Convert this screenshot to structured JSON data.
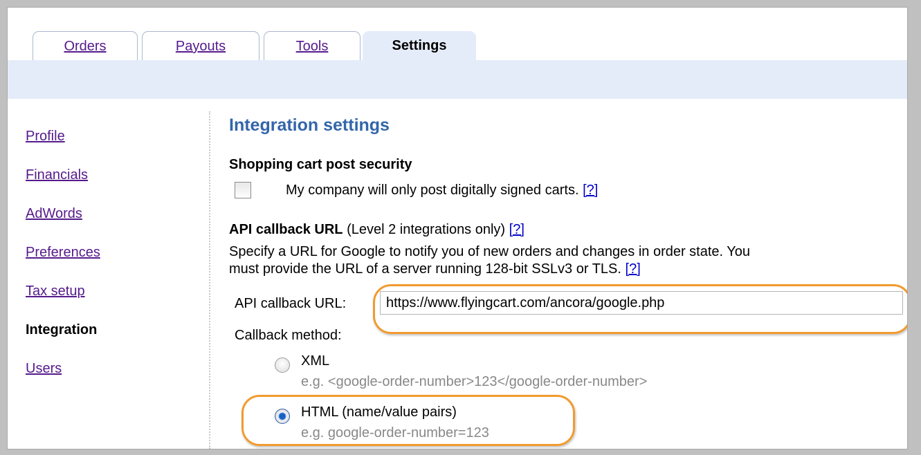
{
  "tabs": [
    {
      "label": "Orders",
      "active": false
    },
    {
      "label": "Payouts",
      "active": false
    },
    {
      "label": "Tools",
      "active": false
    },
    {
      "label": "Settings",
      "active": true
    }
  ],
  "sidebar": {
    "items": [
      {
        "label": "Profile"
      },
      {
        "label": "Financials"
      },
      {
        "label": "AdWords"
      },
      {
        "label": "Preferences"
      },
      {
        "label": "Tax setup"
      },
      {
        "label": "Integration"
      },
      {
        "label": "Users"
      }
    ]
  },
  "main": {
    "title": "Integration settings",
    "post_security": {
      "heading": "Shopping cart post security",
      "checkbox_label": "My company will only post digitally signed carts.",
      "help": "[?]",
      "checked": false
    },
    "callback": {
      "heading": "API callback URL",
      "note": "(Level 2 integrations only)",
      "help": "[?]",
      "desc_line1": "Specify a URL for Google to notify you of new orders and changes in order state. You",
      "desc_line2": "must provide the URL of a server running 128-bit SSLv3 or TLS.",
      "desc_help": "[?]",
      "url_label": "API callback URL:",
      "url_value": "https://www.flyingcart.com/ancora/google.php",
      "method_label": "Callback method:",
      "options": [
        {
          "label": "XML",
          "example": "e.g. <google-order-number>123</google-order-number>",
          "selected": false
        },
        {
          "label": "HTML (name/value pairs)",
          "example": "e.g. google-order-number=123",
          "selected": true
        }
      ]
    }
  },
  "colors": {
    "tab_bar": "#e5ecf9",
    "title": "#3366aa",
    "highlight": "#f29a2e",
    "visited_link": "#551a8b",
    "link": "#0000cc"
  }
}
